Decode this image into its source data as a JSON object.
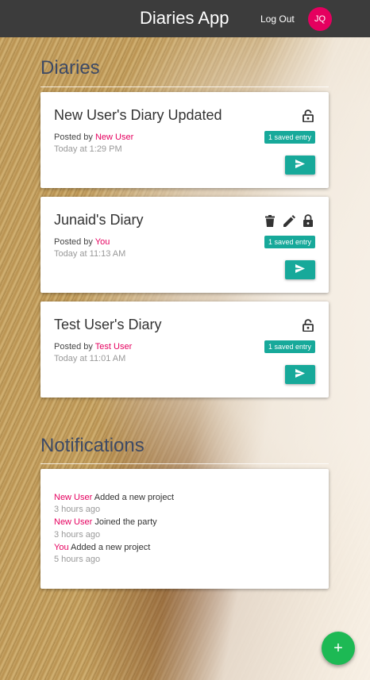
{
  "header": {
    "title": "Diaries App",
    "logout_label": "Log Out",
    "avatar_initials": "JQ"
  },
  "diaries_section": {
    "title": "Diaries"
  },
  "diaries": [
    {
      "title": "New User's Diary Updated",
      "posted_prefix": "Posted by ",
      "author": "New User",
      "time": "Today at 1:29 PM",
      "badge": "1 saved entry",
      "icons": [
        "lock-open-icon"
      ]
    },
    {
      "title": "Junaid's Diary",
      "posted_prefix": "Posted by ",
      "author": "You",
      "time": "Today at 11:13 AM",
      "badge": "1 saved entry",
      "icons": [
        "trash-icon",
        "pencil-icon",
        "lock-icon"
      ]
    },
    {
      "title": "Test User's Diary",
      "posted_prefix": "Posted by ",
      "author": "Test User",
      "time": "Today at 11:01 AM",
      "badge": "1 saved entry",
      "icons": [
        "lock-open-icon"
      ]
    }
  ],
  "notifications_section": {
    "title": "Notifications"
  },
  "notifications": [
    {
      "who": "New User",
      "text": " Added a new project",
      "time": "3 hours ago"
    },
    {
      "who": "New User",
      "text": " Joined the party",
      "time": "3 hours ago"
    },
    {
      "who": "You",
      "text": " Added a new project",
      "time": "5 hours ago"
    }
  ],
  "fab": {
    "label": "+"
  },
  "colors": {
    "accent": "#17a99a",
    "author": "#e5005f",
    "fab": "#1db954",
    "topbar": "#3c3c3c"
  }
}
